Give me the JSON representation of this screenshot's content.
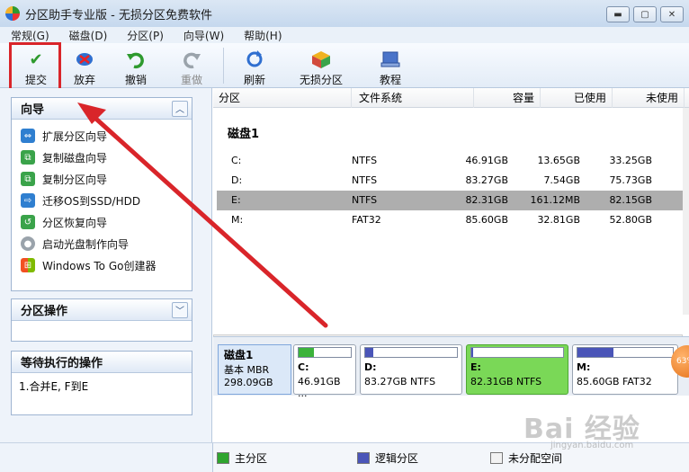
{
  "window": {
    "title": "分区助手专业版 - 无损分区免费软件",
    "minimize": "▬",
    "restore": "▢",
    "close": "✕"
  },
  "menu": [
    "常规(G)",
    "磁盘(D)",
    "分区(P)",
    "向导(W)",
    "帮助(H)"
  ],
  "toolbar": {
    "buttons": [
      {
        "label": "提交",
        "icon": "check-icon"
      },
      {
        "label": "放弃",
        "icon": "discard-icon"
      },
      {
        "label": "撤销",
        "icon": "undo-icon"
      },
      {
        "label": "重做",
        "icon": "redo-icon",
        "disabled": true
      },
      {
        "label": "刷新",
        "icon": "refresh-icon"
      },
      {
        "label": "无损分区",
        "icon": "lossless-partition-icon"
      },
      {
        "label": "教程",
        "icon": "tutorial-icon"
      }
    ]
  },
  "wizard_panel": {
    "title": "向导",
    "items": [
      "扩展分区向导",
      "复制磁盘向导",
      "复制分区向导",
      "迁移OS到SSD/HDD",
      "分区恢复向导",
      "启动光盘制作向导",
      "Windows To Go创建器"
    ]
  },
  "partition_ops_panel": {
    "title": "分区操作"
  },
  "pending_panel": {
    "title": "等待执行的操作",
    "items": [
      "1.合并E, F到E"
    ]
  },
  "table": {
    "headers": [
      "分区",
      "文件系统",
      "容量",
      "已使用",
      "未使用"
    ],
    "disk_label": "磁盘1",
    "rows": [
      {
        "partition": "C:",
        "fs": "NTFS",
        "capacity": "46.91GB",
        "used": "13.65GB",
        "free": "33.25GB"
      },
      {
        "partition": "D:",
        "fs": "NTFS",
        "capacity": "83.27GB",
        "used": "7.54GB",
        "free": "75.73GB"
      },
      {
        "partition": "E:",
        "fs": "NTFS",
        "capacity": "82.31GB",
        "used": "161.12MB",
        "free": "82.15GB",
        "selected": true
      },
      {
        "partition": "M:",
        "fs": "FAT32",
        "capacity": "85.60GB",
        "used": "32.81GB",
        "free": "52.80GB"
      }
    ],
    "scroll_grip": "|||"
  },
  "disk_map": {
    "disk": {
      "name": "磁盘1",
      "type": "基本 MBR",
      "size": "298.09GB"
    },
    "partitions": [
      {
        "name": "C:",
        "desc": "46.91GB ...",
        "fill": 0.29,
        "fill_color": "#3bb33b"
      },
      {
        "name": "D:",
        "desc": "83.27GB NTFS",
        "fill": 0.09,
        "fill_color": "#4a55b8"
      },
      {
        "name": "E:",
        "desc": "82.31GB NTFS",
        "fill": 0.02,
        "fill_color": "#4a55b8",
        "selected": true
      },
      {
        "name": "M:",
        "desc": "85.60GB FAT32",
        "fill": 0.38,
        "fill_color": "#4a55b8"
      }
    ]
  },
  "legend": [
    {
      "label": "主分区",
      "color": "#2fa52f"
    },
    {
      "label": "逻辑分区",
      "color": "#4a55b8"
    },
    {
      "label": "未分配空间",
      "color": "#f2f2f2"
    }
  ],
  "overlay": {
    "badge": "63%",
    "watermark": "Bai 经验",
    "watermark_sub": "jingyan.baidu.com"
  },
  "colors": {
    "highlight": "#d9252a",
    "arrow": "#d9252a",
    "selected_row": "#aeaeae"
  }
}
